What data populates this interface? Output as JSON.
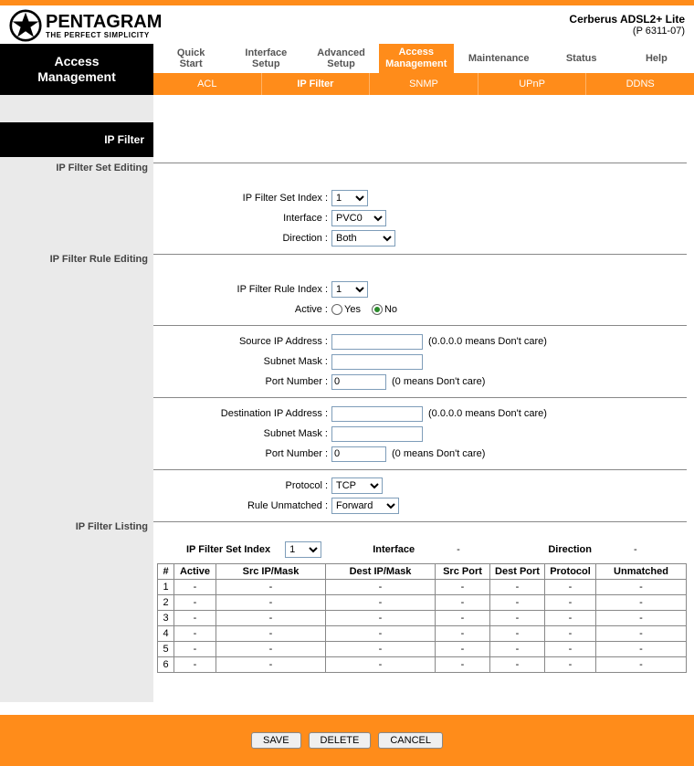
{
  "header": {
    "brand": "PENTAGRAM",
    "tagline": "THE PERFECT SIMPLICITY",
    "device": "Cerberus ADSL2+ Lite",
    "model": "(P 6311-07)"
  },
  "nav": {
    "current_section": "Access\nManagement",
    "main_tabs": [
      {
        "line1": "Quick",
        "line2": "Start",
        "active": false
      },
      {
        "line1": "Interface",
        "line2": "Setup",
        "active": false
      },
      {
        "line1": "Advanced",
        "line2": "Setup",
        "active": false
      },
      {
        "line1": "Access",
        "line2": "Management",
        "active": true
      },
      {
        "line1": "Maintenance",
        "line2": "",
        "active": false
      },
      {
        "line1": "Status",
        "line2": "",
        "active": false
      },
      {
        "line1": "Help",
        "line2": "",
        "active": false
      }
    ],
    "sub_tabs": [
      {
        "label": "ACL",
        "active": false
      },
      {
        "label": "IP Filter",
        "active": true
      },
      {
        "label": "SNMP",
        "active": false
      },
      {
        "label": "UPnP",
        "active": false
      },
      {
        "label": "DDNS",
        "active": false
      }
    ]
  },
  "sections": {
    "page_title": "IP Filter",
    "set_editing_label": "IP Filter Set Editing",
    "rule_editing_label": "IP Filter Rule Editing",
    "listing_label": "IP Filter Listing"
  },
  "set_editing": {
    "set_index_label": "IP Filter Set Index :",
    "set_index_value": "1",
    "interface_label": "Interface :",
    "interface_value": "PVC0",
    "direction_label": "Direction :",
    "direction_value": "Both"
  },
  "rule_editing": {
    "rule_index_label": "IP Filter Rule Index :",
    "rule_index_value": "1",
    "active_label": "Active :",
    "active_yes": "Yes",
    "active_no": "No",
    "active_value": "No",
    "src_ip_label": "Source IP Address :",
    "src_ip_value": "",
    "src_ip_hint": "(0.0.0.0 means Don't care)",
    "src_mask_label": "Subnet Mask :",
    "src_mask_value": "",
    "src_port_label": "Port Number :",
    "src_port_value": "0",
    "src_port_hint": "(0 means Don't care)",
    "dst_ip_label": "Destination IP Address :",
    "dst_ip_value": "",
    "dst_ip_hint": "(0.0.0.0 means Don't care)",
    "dst_mask_label": "Subnet Mask :",
    "dst_mask_value": "",
    "dst_port_label": "Port Number :",
    "dst_port_value": "0",
    "dst_port_hint": "(0 means Don't care)",
    "protocol_label": "Protocol :",
    "protocol_value": "TCP",
    "unmatched_label": "Rule Unmatched :",
    "unmatched_value": "Forward"
  },
  "listing": {
    "header": {
      "set_index_label": "IP Filter Set Index",
      "set_index_value": "1",
      "interface_label": "Interface",
      "interface_value": "-",
      "direction_label": "Direction",
      "direction_value": "-"
    },
    "columns": [
      "#",
      "Active",
      "Src IP/Mask",
      "Dest IP/Mask",
      "Src Port",
      "Dest Port",
      "Protocol",
      "Unmatched"
    ],
    "rows": [
      {
        "n": "1",
        "active": "-",
        "src": "-",
        "dst": "-",
        "sp": "-",
        "dp": "-",
        "proto": "-",
        "um": "-"
      },
      {
        "n": "2",
        "active": "-",
        "src": "-",
        "dst": "-",
        "sp": "-",
        "dp": "-",
        "proto": "-",
        "um": "-"
      },
      {
        "n": "3",
        "active": "-",
        "src": "-",
        "dst": "-",
        "sp": "-",
        "dp": "-",
        "proto": "-",
        "um": "-"
      },
      {
        "n": "4",
        "active": "-",
        "src": "-",
        "dst": "-",
        "sp": "-",
        "dp": "-",
        "proto": "-",
        "um": "-"
      },
      {
        "n": "5",
        "active": "-",
        "src": "-",
        "dst": "-",
        "sp": "-",
        "dp": "-",
        "proto": "-",
        "um": "-"
      },
      {
        "n": "6",
        "active": "-",
        "src": "-",
        "dst": "-",
        "sp": "-",
        "dp": "-",
        "proto": "-",
        "um": "-"
      }
    ]
  },
  "footer": {
    "save": "SAVE",
    "delete": "DELETE",
    "cancel": "CANCEL"
  }
}
